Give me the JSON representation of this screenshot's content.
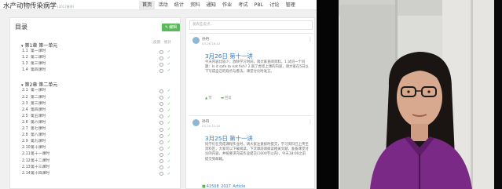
{
  "header": {
    "site_title": "水产动物传染病学",
    "site_subtitle": "(2017春季)",
    "nav": [
      "首页",
      "活动",
      "统计",
      "资料",
      "通知",
      "作业",
      "考试",
      "PBL",
      "讨论",
      "管理"
    ]
  },
  "left_panel": {
    "title": "目录",
    "edit_label": "编辑",
    "columns": [
      "反馈",
      "统计"
    ],
    "units": [
      {
        "title": "第1章 第一单元",
        "lessons": [
          {
            "num": "1.1",
            "title": "第一课时",
            "done": true
          },
          {
            "num": "1.2",
            "title": "第二课时",
            "done": true
          },
          {
            "num": "1.3",
            "title": "第三课时",
            "done": true
          },
          {
            "num": "1.4",
            "title": "第四课时",
            "done": true
          }
        ]
      },
      {
        "title": "第2章 第二单元",
        "lessons": [
          {
            "num": "2.1",
            "title": "第一课时",
            "done": true
          },
          {
            "num": "2.2",
            "title": "第二课时",
            "done": true
          },
          {
            "num": "2.3",
            "title": "第三课时",
            "done": true
          },
          {
            "num": "2.4",
            "title": "第四课时",
            "done": true
          },
          {
            "num": "2.5",
            "title": "第五课时",
            "done": true
          },
          {
            "num": "2.6",
            "title": "第六课时",
            "done": true
          },
          {
            "num": "2.7",
            "title": "第七课时",
            "done": true
          },
          {
            "num": "2.8",
            "title": "第八课时",
            "done": true
          },
          {
            "num": "2.9",
            "title": "第九课时",
            "done": true
          },
          {
            "num": "2.10",
            "title": "第十课时",
            "done": true
          },
          {
            "num": "2.11",
            "title": "第十一课时",
            "done": true
          },
          {
            "num": "2.12",
            "title": "第十二课时",
            "done": true
          },
          {
            "num": "2.13",
            "title": "第十三课时",
            "done": true
          },
          {
            "num": "2.14",
            "title": "第十四课时",
            "done": true
          }
        ]
      }
    ]
  },
  "right_panel": {
    "comment_placeholder": "发表些说点...",
    "posts": [
      {
        "author": "孙丹",
        "time": "03-26 18:42",
        "title": "3月26日 第十一讲",
        "body": "今天内容比较少，放映学习时间，请大家查阅资料。1.试问一个问题：Is it safe to eat fish? 2.就了虎怪上课的内容，请大家在5日以下写成自己的观点与看法，课堂讨论时发言。",
        "like_label": "赞",
        "reply_label": "回复"
      },
      {
        "author": "孙丹",
        "time": "03-25 11:20",
        "title": "3月25日 第十一讲",
        "body": "同学们在完成课程作业时，请大家注意按时提交，学习资料已上传至资料区，大家可以下载阅读。下次课前请阅读相关文献，准备课堂讨论的内容，并按要求完成作业提交(1000字以内)，今天18:00之前提交到邮箱。",
        "link": "41508_2017_Article"
      }
    ]
  },
  "webcam": {
    "description": "presenter-video-feed"
  }
}
